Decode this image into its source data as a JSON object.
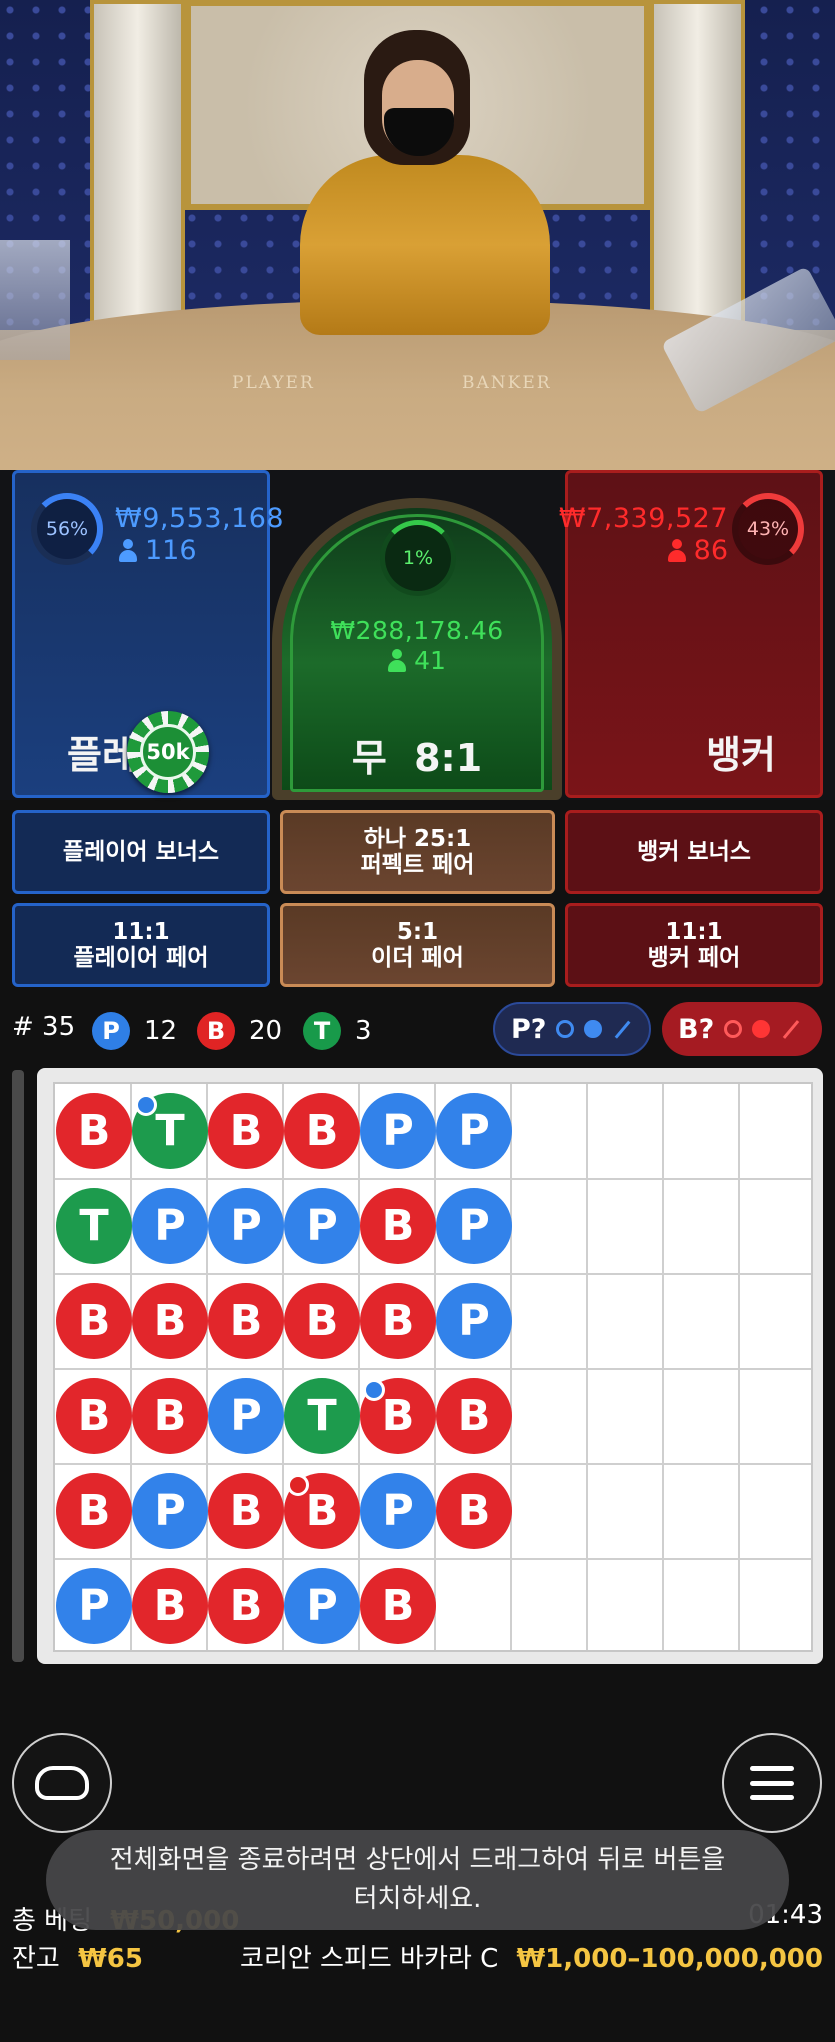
{
  "video": {
    "table_left_word": "PLAYER",
    "table_right_word": "BANKER"
  },
  "player": {
    "percent": "56%",
    "amount": "₩9,553,168",
    "count": "116",
    "label": "플레이어",
    "chip_value": "50k"
  },
  "tie": {
    "percent": "1%",
    "amount": "₩288,178.46",
    "count": "41",
    "label_text": "무",
    "payout": "8:1"
  },
  "banker": {
    "percent": "43%",
    "amount": "₩7,339,527",
    "count": "86",
    "label": "뱅커"
  },
  "side_bets": {
    "player_bonus": "플레이어 보너스",
    "perfect_pair_payout": "하나 25:1",
    "perfect_pair": "퍼펙트 페어",
    "banker_bonus": "뱅커 보너스",
    "player_pair_payout": "11:1",
    "player_pair": "플레이어 페어",
    "either_pair_payout": "5:1",
    "either_pair": "이더 페어",
    "banker_pair_payout": "11:1",
    "banker_pair": "뱅커 페어"
  },
  "stats": {
    "round_label": "# 35",
    "p_letter": "P",
    "p_count": "12",
    "b_letter": "B",
    "b_count": "20",
    "t_letter": "T",
    "t_count": "3",
    "player_predict": "P?",
    "banker_predict": "B?"
  },
  "bead_road": {
    "columns": [
      [
        "B",
        "T",
        "B",
        "B",
        "B",
        "P"
      ],
      [
        "T",
        "P",
        "B",
        "B",
        "P",
        "B"
      ],
      [
        "B",
        "P",
        "B",
        "P",
        "B",
        "B"
      ],
      [
        "B",
        "P",
        "B",
        "T",
        "B",
        "P"
      ],
      [
        "P",
        "B",
        "B",
        "B",
        "P",
        "B"
      ],
      [
        "P",
        "P",
        "P",
        "B",
        "B"
      ]
    ],
    "pairs": [
      {
        "col": 1,
        "row": 0,
        "type": "p"
      },
      {
        "col": 4,
        "row": 3,
        "type": "p"
      },
      {
        "col": 3,
        "row": 4,
        "type": "b"
      }
    ]
  },
  "toast": {
    "line1": "전체화면을 종료하려면 상단에서 드래그하여 뒤로 버튼을",
    "line2": "터치하세요."
  },
  "footer": {
    "total_bet_label": "총 베팅",
    "total_bet_value": "₩50,000",
    "time": "01:43",
    "balance_label": "잔고",
    "balance_value": "₩65",
    "table_name": "코리안 스피드 바카라 C",
    "limits": "₩1,000–100,000,000"
  },
  "colors": {
    "player_blue": "#2f7fe6",
    "banker_red": "#e02424",
    "tie_green": "#189a4a",
    "gold": "#f5c542"
  }
}
